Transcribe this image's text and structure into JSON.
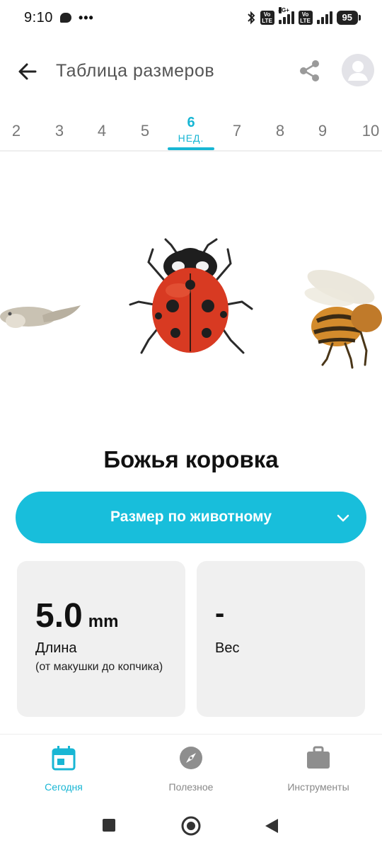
{
  "status_bar": {
    "time": "9:10",
    "dots": "•••",
    "battery": "95",
    "volte": "Vo LTE",
    "network": "4G+"
  },
  "app_bar": {
    "title": "Таблица размеров"
  },
  "weeks": {
    "items": [
      "2",
      "3",
      "4",
      "5",
      "6",
      "7",
      "8",
      "9",
      "10"
    ],
    "active_label": "НЕД."
  },
  "animal": {
    "name": "Божья коровка"
  },
  "dropdown": {
    "label": "Размер по животному"
  },
  "length_card": {
    "value": "5.0",
    "unit": "mm",
    "label": "Длина",
    "sublabel": "(от макушки до копчика)"
  },
  "weight_card": {
    "value": "-",
    "label": "Вес"
  },
  "bottom_nav": {
    "today": "Сегодня",
    "useful": "Полезное",
    "tools": "Инструменты"
  },
  "colors": {
    "accent": "#18bedb",
    "card_bg": "#f0f0f0",
    "ladybug_red": "#d83a22"
  }
}
